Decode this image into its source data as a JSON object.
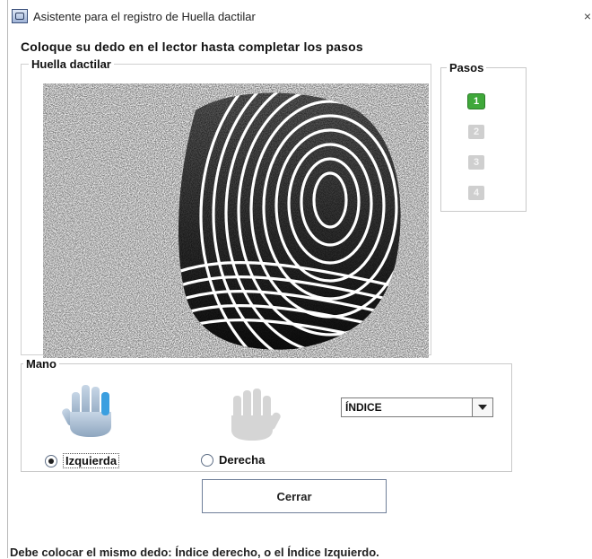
{
  "window": {
    "title": "Asistente para el registro de Huella dactilar",
    "close_glyph": "×",
    "icon": "app-window-icon"
  },
  "instruction": "Coloque su dedo en el lector hasta completar los pasos",
  "fingerprint_panel": {
    "legend": "Huella dactilar",
    "image": "fingerprint-scan"
  },
  "steps_panel": {
    "legend": "Pasos",
    "steps": [
      {
        "label": "1",
        "state": "active"
      },
      {
        "label": "2",
        "state": "inactive"
      },
      {
        "label": "3",
        "state": "inactive"
      },
      {
        "label": "4",
        "state": "inactive"
      }
    ],
    "colors": {
      "active": "#3fa83a",
      "inactive": "#cfcfcf"
    }
  },
  "hand_panel": {
    "legend": "Mano",
    "left_hand_icon": "left-hand-icon",
    "right_hand_icon": "right-hand-icon",
    "radio_left": {
      "label": "Izquierda",
      "checked": true
    },
    "radio_right": {
      "label": "Derecha",
      "checked": false
    },
    "finger_select": {
      "value": "ÍNDICE"
    },
    "highlight_color": "#3b9fe0"
  },
  "buttons": {
    "close_label": "Cerrar"
  },
  "status_text": "Debe colocar el mismo dedo: Índice derecho, o el Índice Izquierdo."
}
